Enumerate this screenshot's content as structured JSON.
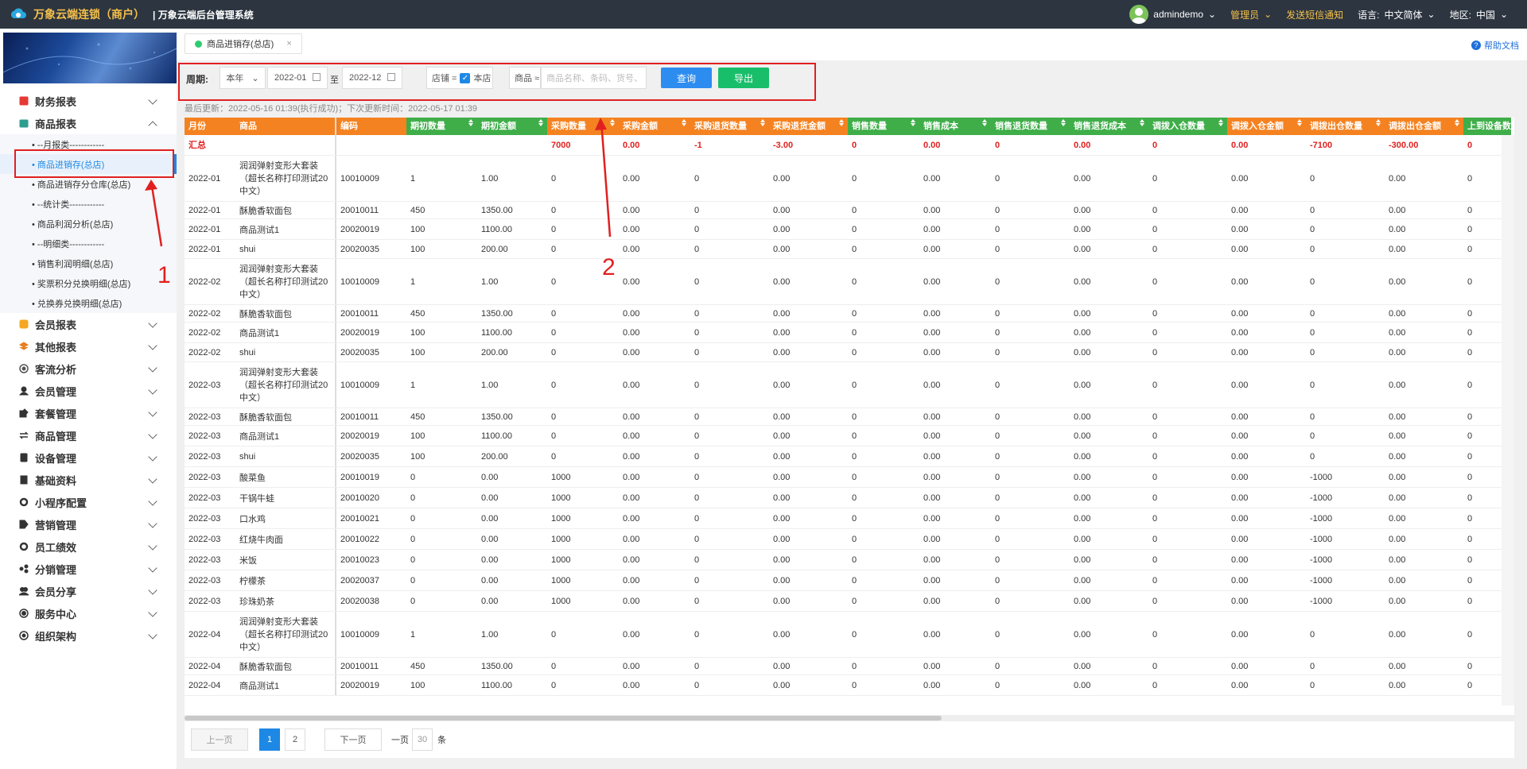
{
  "topbar": {
    "brand": "万象云端连锁（商户）",
    "subtitle": "| 万象云端后台管理系统",
    "user": "admindemo",
    "role": "管理员",
    "sms": "发送短信通知",
    "lang_label": "语言:",
    "lang": "中文简体",
    "region_label": "地区:",
    "region": "中国"
  },
  "sidebar": {
    "items": [
      {
        "label": "财务报表",
        "icon": "chart-icon",
        "color": "#e53935"
      },
      {
        "label": "商品报表",
        "icon": "goods-icon",
        "color": "#2e9e8e",
        "expanded": true,
        "children": [
          {
            "label": "• --月报类------------"
          },
          {
            "label": "• 商品进销存(总店)",
            "active": true
          },
          {
            "label": "• 商品进销存分仓库(总店)"
          },
          {
            "label": "• --统计类------------"
          },
          {
            "label": "• 商品利润分析(总店)"
          },
          {
            "label": "• --明细类------------"
          },
          {
            "label": "• 销售利润明细(总店)"
          },
          {
            "label": "• 奖票积分兑换明细(总店)"
          },
          {
            "label": "• 兑换券兑换明细(总店)"
          }
        ]
      },
      {
        "label": "会员报表",
        "icon": "member-report-icon",
        "color": "#f5a623"
      },
      {
        "label": "其他报表",
        "icon": "layers-icon",
        "color": "#e67e22"
      },
      {
        "label": "客流分析",
        "icon": "target-icon",
        "color": "#555"
      },
      {
        "label": "会员管理",
        "icon": "user-icon",
        "color": "#333"
      },
      {
        "label": "套餐管理",
        "icon": "edit-icon",
        "color": "#333"
      },
      {
        "label": "商品管理",
        "icon": "swap-icon",
        "color": "#333"
      },
      {
        "label": "设备管理",
        "icon": "device-icon",
        "color": "#333"
      },
      {
        "label": "基础资料",
        "icon": "doc-icon",
        "color": "#333"
      },
      {
        "label": "小程序配置",
        "icon": "gear-icon",
        "color": "#333"
      },
      {
        "label": "营销管理",
        "icon": "tag-icon",
        "color": "#333"
      },
      {
        "label": "员工绩效",
        "icon": "gear-icon",
        "color": "#333"
      },
      {
        "label": "分销管理",
        "icon": "share-icon",
        "color": "#333"
      },
      {
        "label": "会员分享",
        "icon": "group-icon",
        "color": "#333"
      },
      {
        "label": "服务中心",
        "icon": "service-icon",
        "color": "#333"
      },
      {
        "label": "组织架构",
        "icon": "org-icon",
        "color": "#333"
      }
    ]
  },
  "tab": {
    "label": "商品进销存(总店)",
    "close": "×"
  },
  "help": "帮助文档",
  "filters": {
    "period_label": "周期:",
    "period_value": "本年",
    "date_from": "2022-01",
    "to_label": "至",
    "date_to": "2022-12",
    "store_label": "店铺 =",
    "store_value": "本店",
    "goods_label": "商品 ≈",
    "goods_placeholder": "商品名称、条码、货号、",
    "query": "查询",
    "export": "导出"
  },
  "annotations": {
    "n1": "1",
    "n2": "2"
  },
  "update_text": "最后更新：2022-05-16 01:39(执行成功)；下次更新时间：2022-05-17 01:39",
  "table": {
    "columns": [
      {
        "label": "月份",
        "color": "or",
        "sort": false
      },
      {
        "label": "商品",
        "color": "or",
        "sort": false
      },
      {
        "label": "编码",
        "color": "or",
        "sort": false
      },
      {
        "label": "期初数量",
        "color": "gr",
        "sort": true
      },
      {
        "label": "期初金额",
        "color": "gr",
        "sort": true
      },
      {
        "label": "采购数量",
        "color": "or",
        "sort": true
      },
      {
        "label": "采购金额",
        "color": "or",
        "sort": true
      },
      {
        "label": "采购退货数量",
        "color": "or",
        "sort": true
      },
      {
        "label": "采购退货金额",
        "color": "or",
        "sort": true
      },
      {
        "label": "销售数量",
        "color": "gr",
        "sort": true
      },
      {
        "label": "销售成本",
        "color": "gr",
        "sort": true
      },
      {
        "label": "销售退货数量",
        "color": "gr",
        "sort": true
      },
      {
        "label": "销售退货成本",
        "color": "gr",
        "sort": true
      },
      {
        "label": "调拨入仓数量",
        "color": "gr",
        "sort": true
      },
      {
        "label": "调拨入仓金额",
        "color": "or",
        "sort": true
      },
      {
        "label": "调拨出仓数量",
        "color": "or",
        "sort": true
      },
      {
        "label": "调拨出仓金额",
        "color": "or",
        "sort": true
      },
      {
        "label": "上到设备数量",
        "color": "gr",
        "sort": false
      }
    ],
    "summary": [
      "汇总",
      "",
      "",
      "",
      "",
      "7000",
      "0.00",
      "-1",
      "-3.00",
      "0",
      "0.00",
      "0",
      "0.00",
      "0",
      "0.00",
      "-7100",
      "-300.00",
      "0"
    ],
    "rows": [
      {
        "h": 58,
        "c": [
          "2022-01",
          "润润弹射变形大套装（超长名称打印测试20中文）",
          "10010009",
          "1",
          "1.00",
          "0",
          "0.00",
          "0",
          "0.00",
          "0",
          "0.00",
          "0",
          "0.00",
          "0",
          "0.00",
          "0",
          "0.00",
          "0"
        ]
      },
      {
        "h": 22,
        "c": [
          "2022-01",
          "酥脆香软面包",
          "20010011",
          "450",
          "1350.00",
          "0",
          "0.00",
          "0",
          "0.00",
          "0",
          "0.00",
          "0",
          "0.00",
          "0",
          "0.00",
          "0",
          "0.00",
          "0"
        ]
      },
      {
        "h": 26,
        "c": [
          "2022-01",
          "商品测试1",
          "20020019",
          "100",
          "1100.00",
          "0",
          "0.00",
          "0",
          "0.00",
          "0",
          "0.00",
          "0",
          "0.00",
          "0",
          "0.00",
          "0",
          "0.00",
          "0"
        ]
      },
      {
        "h": 24,
        "c": [
          "2022-01",
          "shui",
          "20020035",
          "100",
          "200.00",
          "0",
          "0.00",
          "0",
          "0.00",
          "0",
          "0.00",
          "0",
          "0.00",
          "0",
          "0.00",
          "0",
          "0.00",
          "0"
        ]
      },
      {
        "h": 58,
        "c": [
          "2022-02",
          "润润弹射变形大套装（超长名称打印测试20中文）",
          "10010009",
          "1",
          "1.00",
          "0",
          "0.00",
          "0",
          "0.00",
          "0",
          "0.00",
          "0",
          "0.00",
          "0",
          "0.00",
          "0",
          "0.00",
          "0"
        ]
      },
      {
        "h": 22,
        "c": [
          "2022-02",
          "酥脆香软面包",
          "20010011",
          "450",
          "1350.00",
          "0",
          "0.00",
          "0",
          "0.00",
          "0",
          "0.00",
          "0",
          "0.00",
          "0",
          "0.00",
          "0",
          "0.00",
          "0"
        ]
      },
      {
        "h": 26,
        "c": [
          "2022-02",
          "商品测试1",
          "20020019",
          "100",
          "1100.00",
          "0",
          "0.00",
          "0",
          "0.00",
          "0",
          "0.00",
          "0",
          "0.00",
          "0",
          "0.00",
          "0",
          "0.00",
          "0"
        ]
      },
      {
        "h": 24,
        "c": [
          "2022-02",
          "shui",
          "20020035",
          "100",
          "200.00",
          "0",
          "0.00",
          "0",
          "0.00",
          "0",
          "0.00",
          "0",
          "0.00",
          "0",
          "0.00",
          "0",
          "0.00",
          "0"
        ]
      },
      {
        "h": 58,
        "c": [
          "2022-03",
          "润润弹射变形大套装（超长名称打印测试20中文）",
          "10010009",
          "1",
          "1.00",
          "0",
          "0.00",
          "0",
          "0.00",
          "0",
          "0.00",
          "0",
          "0.00",
          "0",
          "0.00",
          "0",
          "0.00",
          "0"
        ]
      },
      {
        "h": 22,
        "c": [
          "2022-03",
          "酥脆香软面包",
          "20010011",
          "450",
          "1350.00",
          "0",
          "0.00",
          "0",
          "0.00",
          "0",
          "0.00",
          "0",
          "0.00",
          "0",
          "0.00",
          "0",
          "0.00",
          "0"
        ]
      },
      {
        "h": 26,
        "c": [
          "2022-03",
          "商品测试1",
          "20020019",
          "100",
          "1100.00",
          "0",
          "0.00",
          "0",
          "0.00",
          "0",
          "0.00",
          "0",
          "0.00",
          "0",
          "0.00",
          "0",
          "0.00",
          "0"
        ]
      },
      {
        "h": 26,
        "c": [
          "2022-03",
          "shui",
          "20020035",
          "100",
          "200.00",
          "0",
          "0.00",
          "0",
          "0.00",
          "0",
          "0.00",
          "0",
          "0.00",
          "0",
          "0.00",
          "0",
          "0.00",
          "0"
        ]
      },
      {
        "h": 26,
        "c": [
          "2022-03",
          "酸菜鱼",
          "20010019",
          "0",
          "0.00",
          "1000",
          "0.00",
          "0",
          "0.00",
          "0",
          "0.00",
          "0",
          "0.00",
          "0",
          "0.00",
          "-1000",
          "0.00",
          "0"
        ]
      },
      {
        "h": 26,
        "c": [
          "2022-03",
          "干锅牛蛙",
          "20010020",
          "0",
          "0.00",
          "1000",
          "0.00",
          "0",
          "0.00",
          "0",
          "0.00",
          "0",
          "0.00",
          "0",
          "0.00",
          "-1000",
          "0.00",
          "0"
        ]
      },
      {
        "h": 26,
        "c": [
          "2022-03",
          "口水鸡",
          "20010021",
          "0",
          "0.00",
          "1000",
          "0.00",
          "0",
          "0.00",
          "0",
          "0.00",
          "0",
          "0.00",
          "0",
          "0.00",
          "-1000",
          "0.00",
          "0"
        ]
      },
      {
        "h": 26,
        "c": [
          "2022-03",
          "红烧牛肉面",
          "20010022",
          "0",
          "0.00",
          "1000",
          "0.00",
          "0",
          "0.00",
          "0",
          "0.00",
          "0",
          "0.00",
          "0",
          "0.00",
          "-1000",
          "0.00",
          "0"
        ]
      },
      {
        "h": 26,
        "c": [
          "2022-03",
          "米饭",
          "20010023",
          "0",
          "0.00",
          "1000",
          "0.00",
          "0",
          "0.00",
          "0",
          "0.00",
          "0",
          "0.00",
          "0",
          "0.00",
          "-1000",
          "0.00",
          "0"
        ]
      },
      {
        "h": 26,
        "c": [
          "2022-03",
          "柠檬茶",
          "20020037",
          "0",
          "0.00",
          "1000",
          "0.00",
          "0",
          "0.00",
          "0",
          "0.00",
          "0",
          "0.00",
          "0",
          "0.00",
          "-1000",
          "0.00",
          "0"
        ]
      },
      {
        "h": 26,
        "c": [
          "2022-03",
          "珍珠奶茶",
          "20020038",
          "0",
          "0.00",
          "1000",
          "0.00",
          "0",
          "0.00",
          "0",
          "0.00",
          "0",
          "0.00",
          "0",
          "0.00",
          "-1000",
          "0.00",
          "0"
        ]
      },
      {
        "h": 58,
        "c": [
          "2022-04",
          "润润弹射变形大套装（超长名称打印测试20中文）",
          "10010009",
          "1",
          "1.00",
          "0",
          "0.00",
          "0",
          "0.00",
          "0",
          "0.00",
          "0",
          "0.00",
          "0",
          "0.00",
          "0",
          "0.00",
          "0"
        ]
      },
      {
        "h": 22,
        "c": [
          "2022-04",
          "酥脆香软面包",
          "20010011",
          "450",
          "1350.00",
          "0",
          "0.00",
          "0",
          "0.00",
          "0",
          "0.00",
          "0",
          "0.00",
          "0",
          "0.00",
          "0",
          "0.00",
          "0"
        ]
      },
      {
        "h": 26,
        "c": [
          "2022-04",
          "商品测试1",
          "20020019",
          "100",
          "1100.00",
          "0",
          "0.00",
          "0",
          "0.00",
          "0",
          "0.00",
          "0",
          "0.00",
          "0",
          "0.00",
          "0",
          "0.00",
          "0"
        ]
      }
    ]
  },
  "pager": {
    "prev": "上一页",
    "page1": "1",
    "page2": "2",
    "next": "下一页",
    "per_label": "一页",
    "per_value": "30",
    "unit": "条"
  }
}
